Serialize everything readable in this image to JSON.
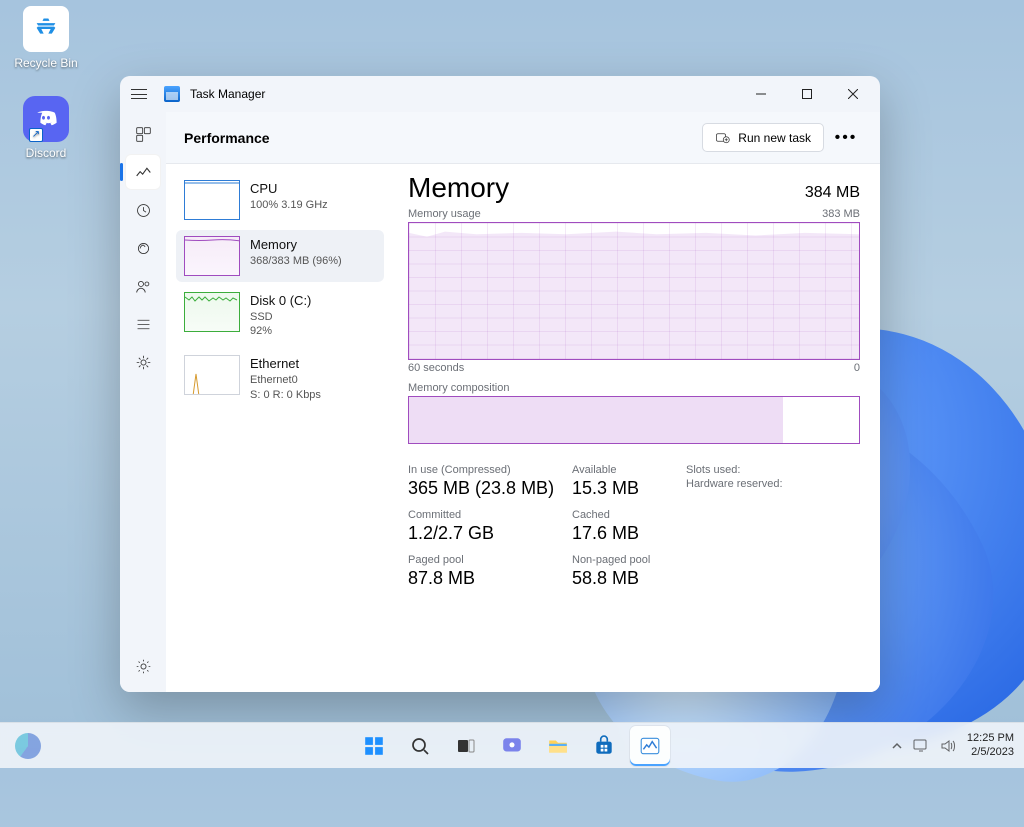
{
  "desktop": {
    "icons": [
      {
        "label": "Recycle Bin"
      },
      {
        "label": "Discord"
      }
    ]
  },
  "window": {
    "title": "Task Manager",
    "page_header": "Performance",
    "run_new_task": "Run new task"
  },
  "rail": {
    "items": [
      "processes",
      "performance",
      "app-history",
      "startup",
      "users",
      "details",
      "services"
    ]
  },
  "cards": {
    "cpu": {
      "name": "CPU",
      "l1": "100% 3.19 GHz"
    },
    "memory": {
      "name": "Memory",
      "l1": "368/383 MB (96%)"
    },
    "disk": {
      "name": "Disk 0 (C:)",
      "l1": "SSD",
      "l2": "92%"
    },
    "ethernet": {
      "name": "Ethernet",
      "l1": "Ethernet0",
      "l2": "S: 0 R: 0 Kbps"
    }
  },
  "detail": {
    "title": "Memory",
    "capacity": "384 MB",
    "usage_label": "Memory usage",
    "usage_peak": "383 MB",
    "axis_left": "60 seconds",
    "axis_right": "0",
    "composition_label": "Memory composition",
    "stats": {
      "inuse_label": "In use (Compressed)",
      "inuse_value": "365 MB (23.8 MB)",
      "avail_label": "Available",
      "avail_value": "15.3 MB",
      "slots_label": "Slots used:",
      "hw_label": "Hardware reserved:",
      "committed_label": "Committed",
      "committed_value": "1.2/2.7 GB",
      "cached_label": "Cached",
      "cached_value": "17.6 MB",
      "paged_label": "Paged pool",
      "paged_value": "87.8 MB",
      "npaged_label": "Non-paged pool",
      "npaged_value": "58.8 MB"
    }
  },
  "taskbar": {
    "time": "12:25 PM",
    "date": "2/5/2023"
  },
  "chart_data": {
    "type": "line",
    "title": "Memory usage",
    "xlabel": "seconds ago",
    "ylabel": "MB",
    "x": [
      60,
      55,
      50,
      45,
      40,
      35,
      30,
      25,
      20,
      15,
      10,
      5,
      0
    ],
    "values": [
      370,
      368,
      372,
      370,
      371,
      369,
      372,
      370,
      371,
      368,
      371,
      369,
      370
    ],
    "ylim": [
      0,
      384
    ],
    "series_name": "Memory usage (MB)",
    "composition": {
      "in_use_pct": 83,
      "available_pct": 17
    }
  }
}
